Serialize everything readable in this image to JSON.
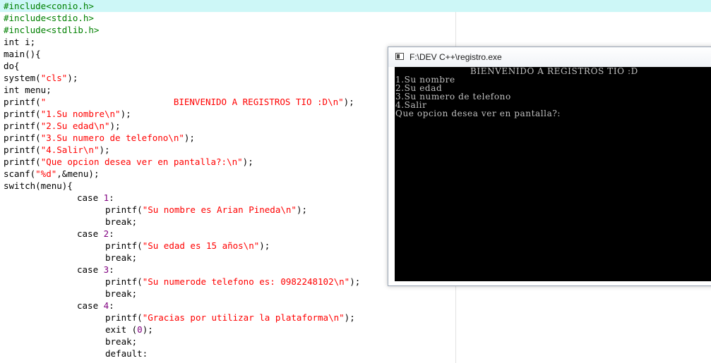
{
  "editor": {
    "lines": [
      {
        "segments": [
          {
            "t": "#include<conio.h>",
            "c": "pre"
          }
        ],
        "indent": 0,
        "active": true
      },
      {
        "segments": [
          {
            "t": "#include<stdio.h>",
            "c": "pre"
          }
        ],
        "indent": 0
      },
      {
        "segments": [
          {
            "t": "#include<stdlib.h>",
            "c": "pre"
          }
        ],
        "indent": 0
      },
      {
        "segments": [
          {
            "t": "int i;",
            "c": "kw"
          }
        ],
        "indent": 0
      },
      {
        "segments": [
          {
            "t": "main(){",
            "c": "kw"
          }
        ],
        "indent": 0
      },
      {
        "segments": [
          {
            "t": "do{",
            "c": "kw"
          }
        ],
        "indent": 0
      },
      {
        "segments": [
          {
            "t": "system(",
            "c": "kw"
          },
          {
            "t": "\"cls\"",
            "c": "str"
          },
          {
            "t": ");",
            "c": "kw"
          }
        ],
        "indent": 0
      },
      {
        "segments": [
          {
            "t": "int menu;",
            "c": "kw"
          }
        ],
        "indent": 0
      },
      {
        "segments": [
          {
            "t": "printf(",
            "c": "kw"
          },
          {
            "t": "\"                        BIENVENIDO A REGISTROS TIO :D\\n\"",
            "c": "str"
          },
          {
            "t": ");",
            "c": "kw"
          }
        ],
        "indent": 0
      },
      {
        "segments": [
          {
            "t": "printf(",
            "c": "kw"
          },
          {
            "t": "\"1.Su nombre\\n\"",
            "c": "str"
          },
          {
            "t": ");",
            "c": "kw"
          }
        ],
        "indent": 0
      },
      {
        "segments": [
          {
            "t": "printf(",
            "c": "kw"
          },
          {
            "t": "\"2.Su edad\\n\"",
            "c": "str"
          },
          {
            "t": ");",
            "c": "kw"
          }
        ],
        "indent": 0
      },
      {
        "segments": [
          {
            "t": "printf(",
            "c": "kw"
          },
          {
            "t": "\"3.Su numero de telefono\\n\"",
            "c": "str"
          },
          {
            "t": ");",
            "c": "kw"
          }
        ],
        "indent": 0
      },
      {
        "segments": [
          {
            "t": "printf(",
            "c": "kw"
          },
          {
            "t": "\"4.Salir\\n\"",
            "c": "str"
          },
          {
            "t": ");",
            "c": "kw"
          }
        ],
        "indent": 0
      },
      {
        "segments": [
          {
            "t": "printf(",
            "c": "kw"
          },
          {
            "t": "\"Que opcion desea ver en pantalla?:\\n\"",
            "c": "str"
          },
          {
            "t": ");",
            "c": "kw"
          }
        ],
        "indent": 0
      },
      {
        "segments": [
          {
            "t": "scanf(",
            "c": "kw"
          },
          {
            "t": "\"%d\"",
            "c": "str"
          },
          {
            "t": ",&menu);",
            "c": "kw"
          }
        ],
        "indent": 0
      },
      {
        "segments": [
          {
            "t": "switch(menu){",
            "c": "kw"
          }
        ],
        "indent": 0
      },
      {
        "segments": [
          {
            "t": "case ",
            "c": "kw"
          },
          {
            "t": "1",
            "c": "num"
          },
          {
            "t": ":",
            "c": "kw"
          }
        ],
        "indent": 1
      },
      {
        "segments": [
          {
            "t": "printf(",
            "c": "kw"
          },
          {
            "t": "\"Su nombre es Arian Pineda\\n\"",
            "c": "str"
          },
          {
            "t": ");",
            "c": "kw"
          }
        ],
        "indent": 2
      },
      {
        "segments": [
          {
            "t": "break;",
            "c": "kw"
          }
        ],
        "indent": 2
      },
      {
        "segments": [
          {
            "t": "case ",
            "c": "kw"
          },
          {
            "t": "2",
            "c": "num"
          },
          {
            "t": ":",
            "c": "kw"
          }
        ],
        "indent": 1
      },
      {
        "segments": [
          {
            "t": "printf(",
            "c": "kw"
          },
          {
            "t": "\"Su edad es 15 años\\n\"",
            "c": "str"
          },
          {
            "t": ");",
            "c": "kw"
          }
        ],
        "indent": 2
      },
      {
        "segments": [
          {
            "t": "break;",
            "c": "kw"
          }
        ],
        "indent": 2
      },
      {
        "segments": [
          {
            "t": "case ",
            "c": "kw"
          },
          {
            "t": "3",
            "c": "num"
          },
          {
            "t": ":",
            "c": "kw"
          }
        ],
        "indent": 1
      },
      {
        "segments": [
          {
            "t": "printf(",
            "c": "kw"
          },
          {
            "t": "\"Su numerode telefono es: 0982248102\\n\"",
            "c": "str"
          },
          {
            "t": ");",
            "c": "kw"
          }
        ],
        "indent": 2
      },
      {
        "segments": [
          {
            "t": "break;",
            "c": "kw"
          }
        ],
        "indent": 2
      },
      {
        "segments": [
          {
            "t": "case ",
            "c": "kw"
          },
          {
            "t": "4",
            "c": "num"
          },
          {
            "t": ":",
            "c": "kw"
          }
        ],
        "indent": 1
      },
      {
        "segments": [
          {
            "t": "printf(",
            "c": "kw"
          },
          {
            "t": "\"Gracias por utilizar la plataforma\\n\"",
            "c": "str"
          },
          {
            "t": ");",
            "c": "kw"
          }
        ],
        "indent": 2
      },
      {
        "segments": [
          {
            "t": "exit (",
            "c": "kw"
          },
          {
            "t": "0",
            "c": "num"
          },
          {
            "t": ");",
            "c": "kw"
          }
        ],
        "indent": 2
      },
      {
        "segments": [
          {
            "t": "break;",
            "c": "kw"
          }
        ],
        "indent": 2
      },
      {
        "segments": [
          {
            "t": "default:",
            "c": "kw"
          }
        ],
        "indent": 2
      }
    ]
  },
  "console": {
    "title": "F:\\DEV C++\\registro.exe",
    "lines": [
      "                        BIENVENIDO A REGISTROS TIO :D",
      "1.Su nombre",
      "2.Su edad",
      "3.Su numero de telefono",
      "4.Salir",
      "Que opcion desea ver en pantalla?:"
    ]
  },
  "colors": {
    "preprocessor": "#008000",
    "string": "#ff0000",
    "number": "#800080",
    "active_line": "#cdf7f7",
    "console_bg": "#000000",
    "console_text": "#c0c0c0"
  }
}
